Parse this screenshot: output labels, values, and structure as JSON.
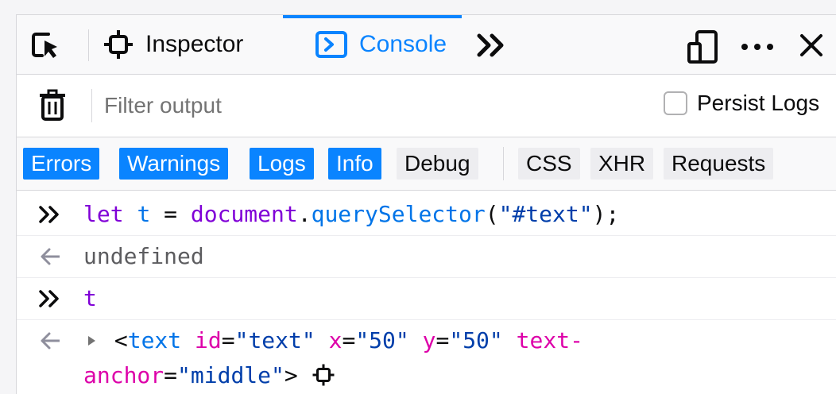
{
  "toolbar": {
    "tabs": [
      {
        "label": "Inspector"
      },
      {
        "label": "Console"
      }
    ]
  },
  "filter": {
    "placeholder": "Filter output",
    "persist_label": "Persist Logs"
  },
  "levels": [
    {
      "label": "Errors",
      "active": true
    },
    {
      "label": "Warnings",
      "active": true
    },
    {
      "label": "Logs",
      "active": true
    },
    {
      "label": "Info",
      "active": true
    },
    {
      "label": "Debug",
      "active": false
    },
    {
      "label": "CSS",
      "active": false
    },
    {
      "label": "XHR",
      "active": false
    },
    {
      "label": "Requests",
      "active": false
    }
  ],
  "console": {
    "input1": {
      "let": "let",
      "var": "t",
      "eq": "=",
      "obj": "document",
      "dot": ".",
      "method": "querySelector",
      "open": "(",
      "arg": "\"#text\"",
      "close": ");"
    },
    "result1": "undefined",
    "input2": "t",
    "result2": {
      "lt": "<",
      "tag": "text",
      "a1": "id",
      "v1": "\"text\"",
      "a2": "x",
      "v2": "\"50\"",
      "a3": "y",
      "v3": "\"50\"",
      "a4_part1": "text-",
      "a4_part2": "anchor",
      "v4": "\"middle\"",
      "eq": "=",
      "gt": ">"
    }
  },
  "colors": {
    "accent": "#0a84ff",
    "keyword": "#8000d7",
    "attribute": "#dd00a9",
    "string": "#003eaa"
  }
}
